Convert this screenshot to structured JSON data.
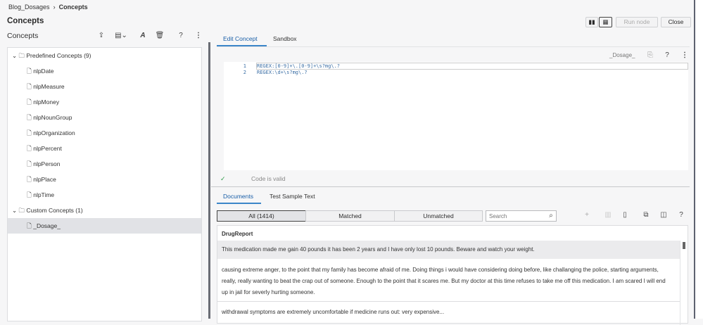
{
  "breadcrumb": {
    "parent": "Blog_Dosages",
    "sep": "›",
    "current": "Concepts"
  },
  "page_title": "Concepts",
  "left": {
    "title": "Concepts",
    "tree": [
      {
        "label": "Predefined Concepts (9)",
        "type": "folder"
      },
      {
        "label": "nlpDate"
      },
      {
        "label": "nlpMeasure"
      },
      {
        "label": "nlpMoney"
      },
      {
        "label": "nlpNounGroup"
      },
      {
        "label": "nlpOrganization"
      },
      {
        "label": "nlpPercent"
      },
      {
        "label": "nlpPerson"
      },
      {
        "label": "nlpPlace"
      },
      {
        "label": "nlpTime"
      },
      {
        "label": "Custom Concepts (1)",
        "type": "folder"
      },
      {
        "label": "_Dosage_",
        "selected": true
      }
    ]
  },
  "header": {
    "run_node": "Run node",
    "close": "Close"
  },
  "tabs": {
    "edit": "Edit Concept",
    "sandbox": "Sandbox"
  },
  "editor": {
    "concept_name": "_Dosage_",
    "lines": [
      {
        "n": "1",
        "text": "REGEX:[0-9]+\\.[0-9]+\\s?mg\\.?"
      },
      {
        "n": "2",
        "text": "REGEX:\\d+\\s?mg\\.?"
      }
    ],
    "status": "Code is valid"
  },
  "bottom_tabs": {
    "documents": "Documents",
    "test": "Test Sample Text"
  },
  "filters": {
    "all": "All (1414)",
    "matched": "Matched",
    "unmatched": "Unmatched",
    "search_placeholder": "Search"
  },
  "table": {
    "header": "DrugReport",
    "rows": [
      "This medication made me gain 40 pounds it has been 2 years and I have only lost 10 pounds. Beware and watch your weight.",
      "causing extreme anger, to the point that my family has become afraid of me. Doing things i would have considering doing before, like challanging the police, starting arguments, really, really wanting to beat the crap out of someone. Enough to the point that it scares me. But my doctor at this time refuses to take me off this medication. I am scared I will end up in jail for severly hurting someone.",
      "withdrawal symptoms are extremely uncomfortable if medicine runs out: very expensive..."
    ]
  }
}
